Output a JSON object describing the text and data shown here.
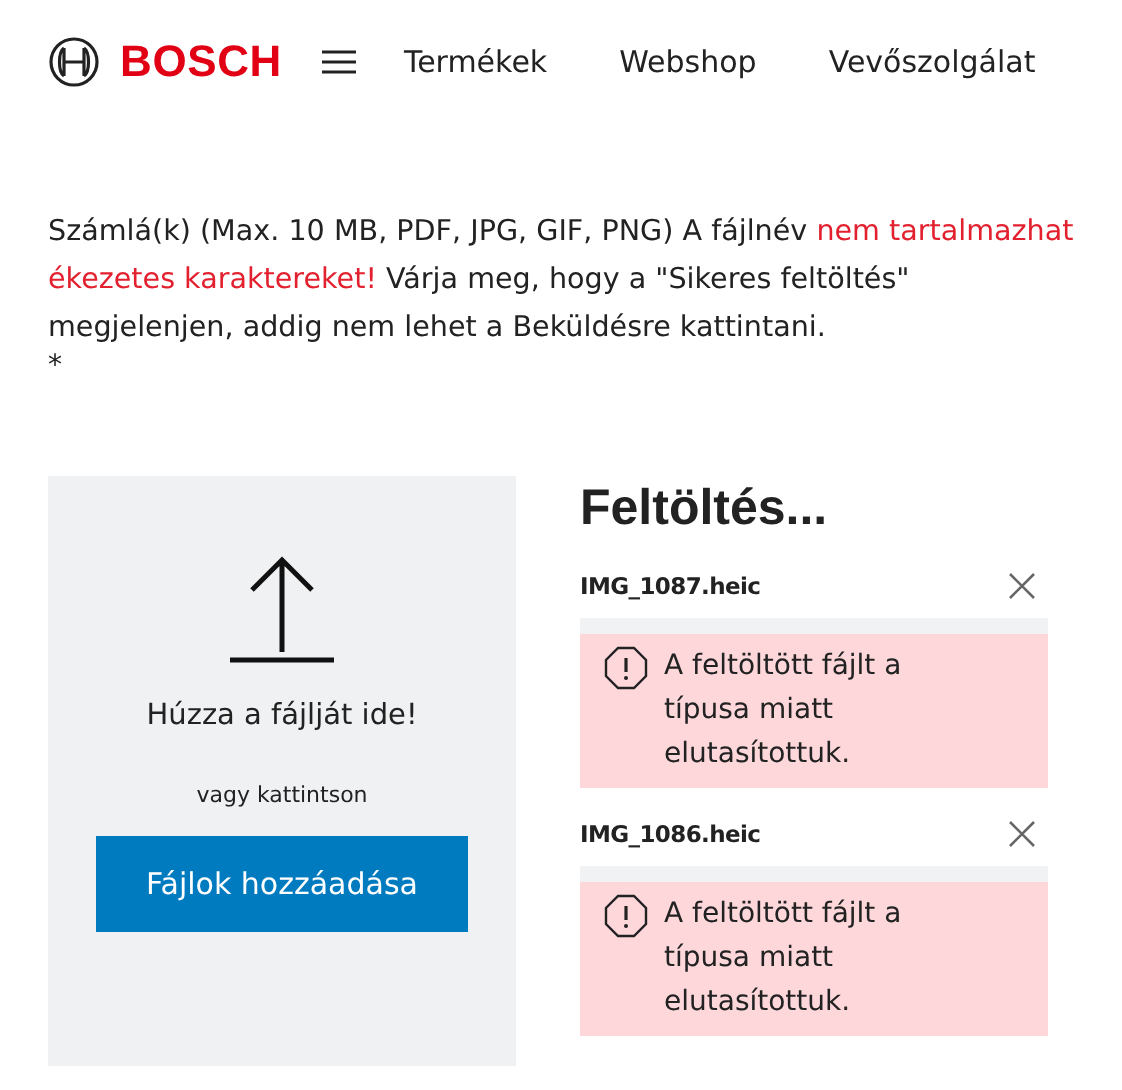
{
  "header": {
    "logo": "BOSCH",
    "nav": [
      "Termékek",
      "Webshop",
      "Vevőszolgálat"
    ]
  },
  "instructions": {
    "before": "Számlá(k) (Max. 10 MB, PDF, JPG, GIF, PNG) A fájlnév ",
    "warning": "nem tartalmazhat ékezetes karaktereket!",
    "after": " Várja meg, hogy a \"Sikeres feltöltés\" megjelenjen, addig nem lehet a Beküldésre kattintani.",
    "required": "*"
  },
  "dropzone": {
    "title": "Húzza a fájlját ide!",
    "subtitle": "vagy kattintson",
    "button": "Fájlok hozzáadása"
  },
  "uploads": {
    "title": "Feltöltés...",
    "files": [
      {
        "name": "IMG_1087.heic",
        "error": "A feltöltött fájlt a típusa miatt elutasítottuk."
      },
      {
        "name": "IMG_1086.heic",
        "error": "A feltöltött fájlt a típusa miatt elutasítottuk."
      }
    ]
  }
}
